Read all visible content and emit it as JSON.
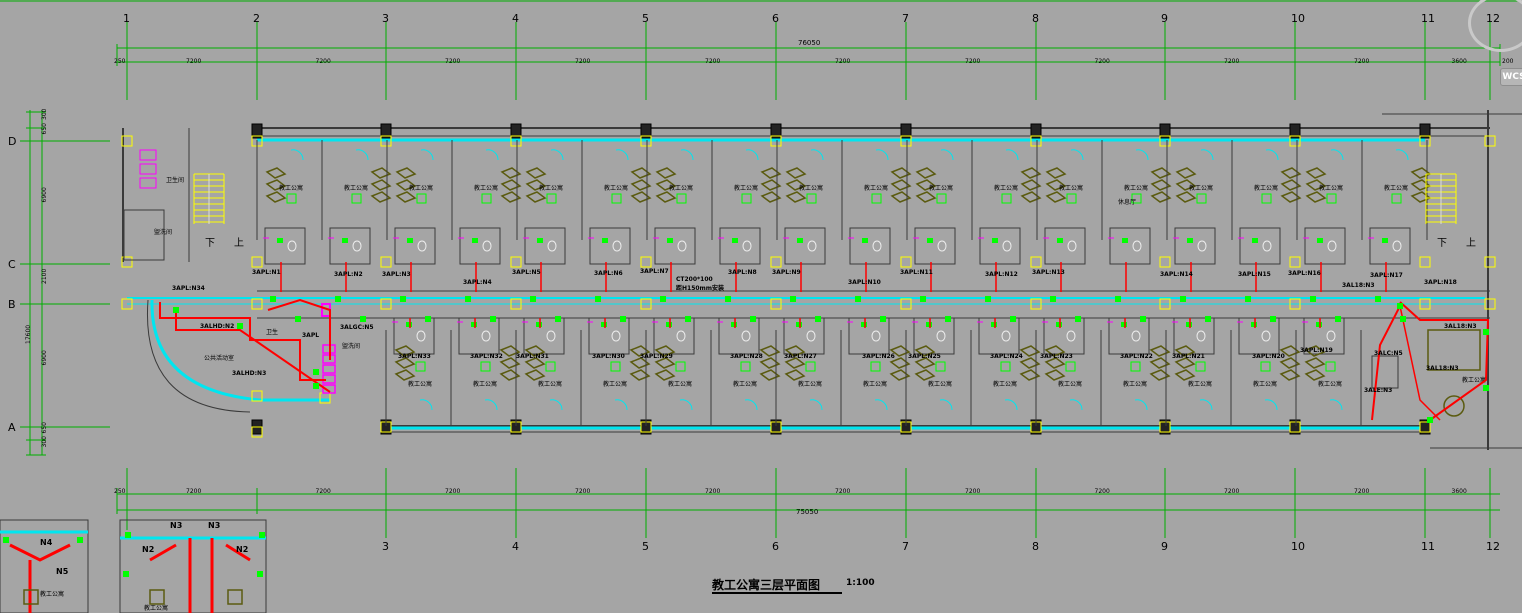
{
  "drawing_title": "教工公寓三层平面图",
  "scale_label": "1:100",
  "viewcube_label": "WCS",
  "grid": {
    "top_numbers": [
      "1",
      "2",
      "3",
      "4",
      "5",
      "6",
      "7",
      "8",
      "9",
      "10",
      "11",
      "12"
    ],
    "bottom_numbers": [
      "3",
      "4",
      "5",
      "6",
      "7",
      "8",
      "9",
      "10",
      "11",
      "12"
    ],
    "row_letters": [
      "D",
      "C",
      "B",
      "A"
    ],
    "top_total_dim": "76050",
    "bottom_total_dim": "75050",
    "top_dims": [
      "250",
      "7200",
      "7200",
      "7200",
      "7200",
      "7200",
      "7200",
      "7200",
      "7200",
      "7200",
      "7200",
      "3600",
      "200"
    ],
    "bottom_dims": [
      "250",
      "7200",
      "7200",
      "7200",
      "7200",
      "7200",
      "7200",
      "7200",
      "7200",
      "7200",
      "7200",
      "3600"
    ],
    "side_total_dim": "17600",
    "side_dims": [
      "300",
      "650",
      "6900",
      "2100",
      "6900",
      "650",
      "300"
    ]
  },
  "room_labels": {
    "apartment": "教工公寓",
    "toilet": "卫生间",
    "wash_room": "盥洗间",
    "leisure_hall": "休息厅",
    "public_activity": "公共活动室",
    "stair_down": "下",
    "stair_up": "上"
  },
  "panel_labels": {
    "upper": [
      "3APL:N1",
      "3APL:N2",
      "3APL:N3",
      "3APL:N4",
      "3APL:N5",
      "3APL:N6",
      "3APL:N7",
      "3APL:N8",
      "3APL:N9",
      "3APL:N10",
      "3APL:N11",
      "3APL:N12",
      "3APL:N13",
      "3APL:N14",
      "3APL:N15",
      "3APL:N16",
      "3APL:N17",
      "3APL:N18"
    ],
    "lower": [
      "3APL:N33",
      "3APL:N32",
      "3APL:N31",
      "3APL:N30",
      "3APL:N29",
      "3APL:N28",
      "3APL:N27",
      "3APL:N26",
      "3APL:N25",
      "3APL:N24",
      "3APL:N23",
      "3APL:N22",
      "3APL:N21",
      "3APL:N20",
      "3APL:N19"
    ],
    "west": [
      "3APL:N34",
      "3ALHD:N2",
      "3ALHD:N3",
      "3ALGC:N5",
      "3APL"
    ],
    "east": [
      "3AL18:N3",
      "3AL18:N3",
      "3ALC:N5",
      "3AL18:N3",
      "3ALE:N3"
    ],
    "tray_note_1": "CT200*100",
    "tray_note_2": "距H150mm安装"
  },
  "mini_plan": {
    "labels": [
      "N3",
      "N3",
      "N2",
      "N2",
      "N4",
      "N5"
    ]
  },
  "colors": {
    "background": "#a5a5a5",
    "wall": "#3a3a3a",
    "grid_line": "#00b000",
    "cyan": "#00e6f0",
    "red": "#ff0000",
    "green": "#00ff00",
    "yellow": "#ffff00",
    "magenta": "#ff00ff",
    "furniture": "#5b5b10",
    "text": "#000000"
  }
}
